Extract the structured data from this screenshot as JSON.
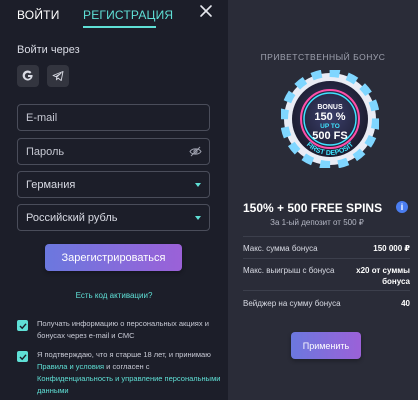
{
  "tabs": {
    "login": "ВОЙТИ",
    "register": "РЕГИСТРАЦИЯ"
  },
  "icons": {
    "close": "close-icon",
    "google": "google-icon",
    "telegram": "telegram-icon",
    "eye": "eye-off-icon",
    "info": "info-icon"
  },
  "login_via": "Войти через",
  "form": {
    "email_placeholder": "E-mail",
    "password_placeholder": "Пароль",
    "country_value": "Германия",
    "currency_value": "Российский рубль"
  },
  "register_button": "Зарегистрироваться",
  "activation_link": "Есть код активации?",
  "consents": {
    "marketing": "Получать информацию о персональных акциях и бонусах через e-mail и СМС",
    "terms_prefix": "Я подтверждаю, что я старше 18 лет, и принимаю ",
    "terms_link": "Правила и условия",
    "terms_middle": " и согласен с ",
    "privacy_link": "Конфиденциальность и управление персональными данными"
  },
  "bonus": {
    "header": "ПРИВЕТСТВЕННЫЙ БОНУС",
    "chip_line1": "BONUS",
    "chip_line2": "150 %",
    "chip_line3": "UP TO",
    "chip_line4": "500 FS",
    "chip_arc": "FIRST DEPOSIT",
    "title": "150% + 500 FREE SPINS",
    "subtitle": "За 1-ый депозит от 500 ₽",
    "rows": [
      {
        "label": "Макс. сумма бонуса",
        "value": "150 000 ₽"
      },
      {
        "label": "Макс. выигрыш с бонуса",
        "value": "x20 от суммы бонуса"
      },
      {
        "label": "Вейджер на сумму бонуса",
        "value": "40"
      }
    ],
    "apply_button": "Применить",
    "info_glyph": "i"
  },
  "colors": {
    "accent": "#5fe0d6",
    "button_start": "#6b78de",
    "button_end": "#9b61d8",
    "panel": "#2a2c38",
    "background": "#1c1e29"
  }
}
